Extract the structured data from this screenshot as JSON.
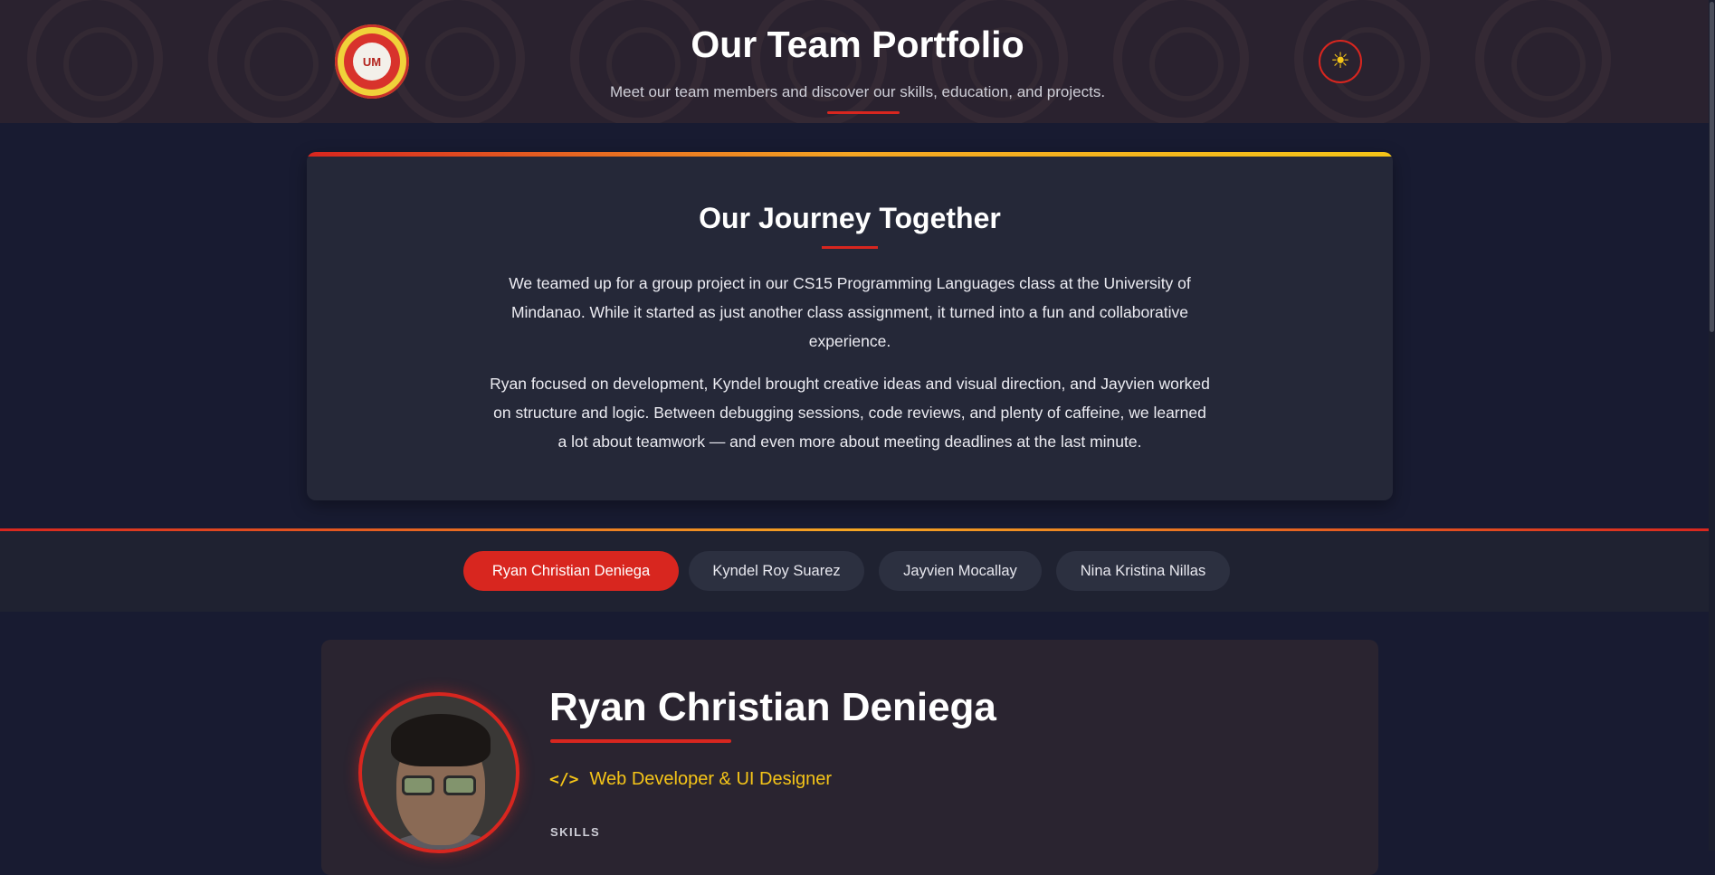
{
  "header": {
    "title": "Our Team Portfolio",
    "subtitle": "Meet our team members and discover our skills, education, and projects.",
    "logo_text": "UM",
    "theme_toggle_icon": "sun-icon"
  },
  "journey": {
    "title": "Our Journey Together",
    "paragraph_1": "We teamed up for a group project in our CS15 Programming Languages class at the University of Mindanao. While it started as just another class assignment, it turned into a fun and collaborative experience.",
    "paragraph_2": "Ryan focused on development, Kyndel brought creative ideas and visual direction, and Jayvien worked on structure and logic. Between debugging sessions, code reviews, and plenty of caffeine, we learned a lot about teamwork — and even more about meeting deadlines at the last minute."
  },
  "members_nav": {
    "tabs": [
      {
        "label": "Ryan Christian Deniega",
        "active": true
      },
      {
        "label": "Kyndel Roy Suarez",
        "active": false
      },
      {
        "label": "Jayvien Mocallay",
        "active": false
      },
      {
        "label": "Nina Kristina Nillas",
        "active": false
      }
    ]
  },
  "profile": {
    "name": "Ryan Christian Deniega",
    "role": "Web Developer & UI Designer",
    "role_icon": "code-icon",
    "skills_label": "SKILLS"
  },
  "colors": {
    "accent_red": "#d8261f",
    "accent_yellow": "#f5c518",
    "background": "#181b31",
    "card": "#252838"
  }
}
